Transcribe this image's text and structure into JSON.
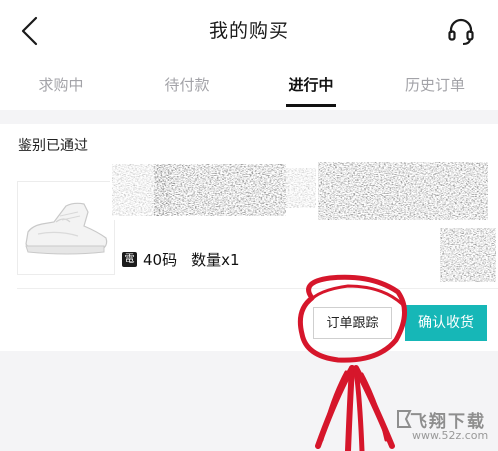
{
  "header": {
    "title": "我的购买",
    "back_icon": "chevron-left-icon",
    "service_icon": "headset-icon"
  },
  "tabs": [
    {
      "label": "求购中",
      "active": false
    },
    {
      "label": "待付款",
      "active": false
    },
    {
      "label": "进行中",
      "active": true
    },
    {
      "label": "历史订单",
      "active": false
    }
  ],
  "order": {
    "status": "鉴别已通过",
    "product_image": "white-sneaker",
    "brand_icon": "電",
    "size": "40码",
    "quantity": "数量x1",
    "actions": {
      "track": "订单跟踪",
      "confirm": "确认收货"
    }
  },
  "watermark": {
    "main": "飞翔下载",
    "sub": "www.52z.com"
  },
  "colors": {
    "accent": "#16b7b7",
    "annotation": "#d6162b"
  }
}
